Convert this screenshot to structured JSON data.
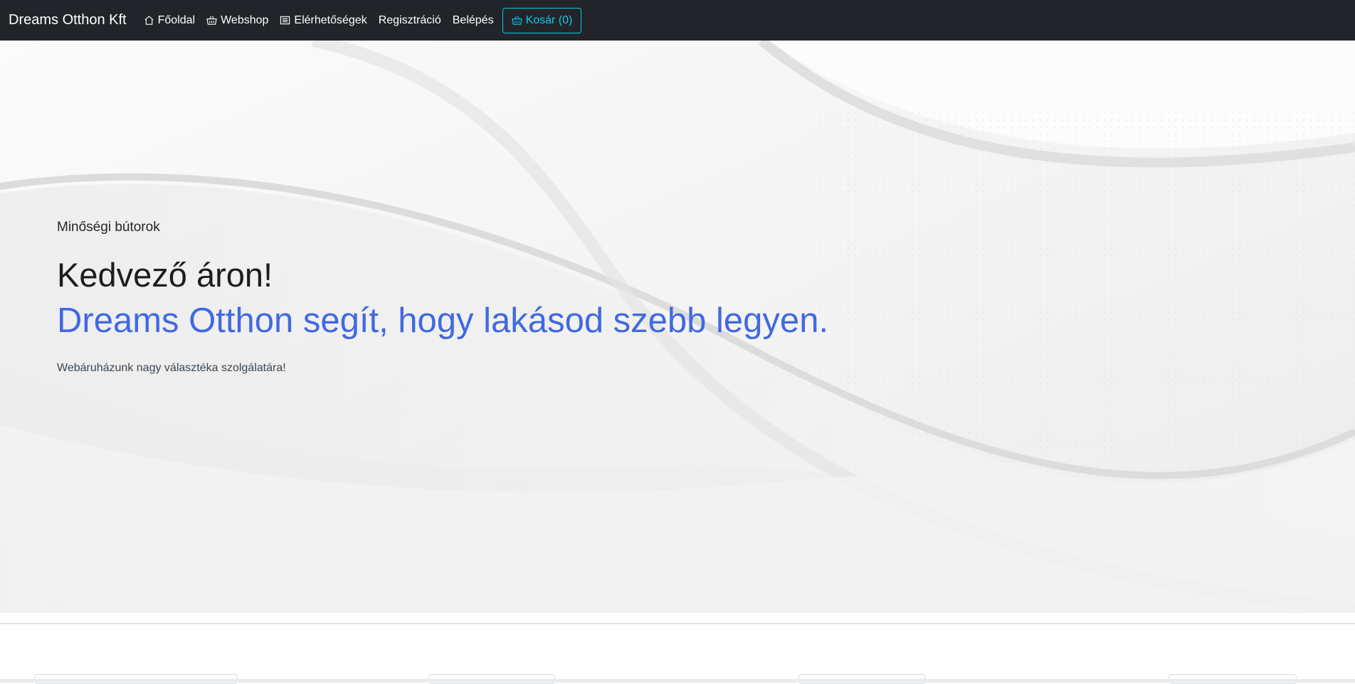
{
  "navbar": {
    "brand": "Dreams Otthon Kft",
    "links": [
      {
        "label": "Főoldal",
        "icon": "house-icon"
      },
      {
        "label": "Webshop",
        "icon": "basket-icon"
      },
      {
        "label": "Elérhetőségek",
        "icon": "list-icon"
      },
      {
        "label": "Regisztráció"
      },
      {
        "label": "Belépés"
      }
    ],
    "cart": {
      "label": "Kosár (0)",
      "icon": "basket-icon"
    }
  },
  "hero": {
    "subtitle": "Minőségi bútorok",
    "headline": "Kedvező áron!",
    "tagline": "Dreams Otthon segít, hogy lakásod szebb legyen.",
    "text": "Webáruházunk nagy választéka szolgálatára!"
  },
  "colors": {
    "navbar_bg": "#212529",
    "accent_cyan": "#0dcaf0",
    "tagline_blue": "#4169e1"
  }
}
